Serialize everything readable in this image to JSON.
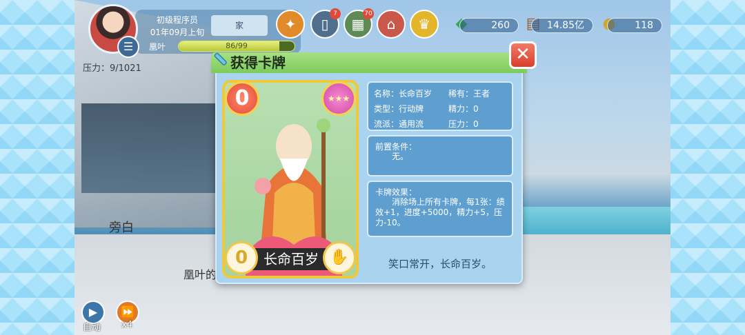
{
  "player": {
    "rank": "初级程序员",
    "date": "01年09月上旬",
    "home_label": "家",
    "energy_name": "凰叶",
    "energy_text": "86/99",
    "energy_ratio": 0.87,
    "stress_text": "压力：9/1021"
  },
  "hud_icons": [
    {
      "name": "event-icon",
      "glyph": "✦"
    },
    {
      "name": "phone-icon",
      "glyph": "▯",
      "badge": "7"
    },
    {
      "name": "cards-icon",
      "glyph": "▦",
      "badge": "70"
    },
    {
      "name": "house-icon",
      "glyph": "⌂"
    },
    {
      "name": "crown-icon",
      "glyph": "♛"
    }
  ],
  "resources": [
    {
      "name": "chips",
      "value": "260"
    },
    {
      "name": "money",
      "value": "14.85亿"
    },
    {
      "name": "medal",
      "value": "118"
    }
  ],
  "scene": {
    "narrator": "旁白",
    "dialog_fragment": "凰叶的"
  },
  "controls": {
    "auto_label": "自动",
    "speed_label": "x4"
  },
  "modal": {
    "title": "获得卡牌",
    "close_glyph": "✕",
    "card": {
      "cost": "0",
      "temperature": "0",
      "name": "长命百岁"
    },
    "stats": {
      "name": "名称：长命百岁",
      "rarity": "稀有：王者",
      "type": "类型：行动牌",
      "spirit": "精力：0",
      "school": "流派：通用流",
      "pressure": "压力：0"
    },
    "prereq_title": "前置条件：",
    "prereq_body": "无。",
    "effect_title": "卡牌效果：",
    "effect_body": "消除场上所有卡牌，每1张：绩效+1，进度+5000，精力+5，压力-10。",
    "quote": "笑口常开，长命百岁。"
  }
}
